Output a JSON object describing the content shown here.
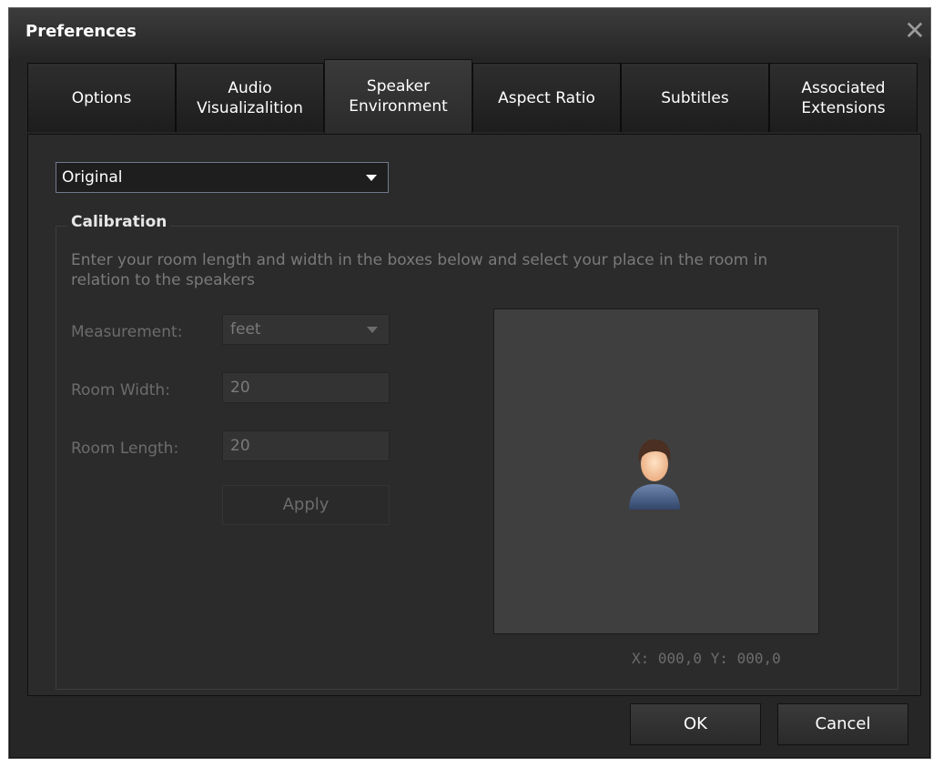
{
  "window": {
    "title": "Preferences",
    "close_glyph": "✕"
  },
  "tabs": [
    {
      "label": "Options"
    },
    {
      "label": "Audio\nVisualizalition"
    },
    {
      "label": "Speaker\nEnvironment",
      "active": true
    },
    {
      "label": "Aspect Ratio"
    },
    {
      "label": "Subtitles"
    },
    {
      "label": "Associated\nExtensions"
    }
  ],
  "preset": {
    "value": "Original"
  },
  "calibration": {
    "title": "Calibration",
    "description": "Enter your room length and width in the boxes below and select your place in the room in relation to the speakers",
    "measurement_label": "Measurement:",
    "measurement_value": "feet",
    "width_label": "Room Width:",
    "width_value": "20",
    "length_label": "Room Length:",
    "length_value": "20",
    "apply_label": "Apply",
    "listener_icon": "user-avatar-icon",
    "coords": "X: 000,0  Y: 000,0"
  },
  "buttons": {
    "ok": "OK",
    "cancel": "Cancel"
  },
  "colors": {
    "window_bg": "#262626",
    "panel_bg": "#2b2b2b",
    "room_bg": "#3f3f3f",
    "select_border": "#6f7a8c"
  }
}
